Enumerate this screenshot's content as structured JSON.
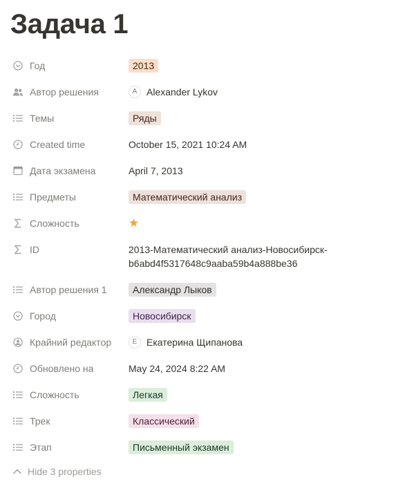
{
  "page": {
    "title": "Задача 1"
  },
  "properties": [
    {
      "key": "Год",
      "icon": "select-icon",
      "type": "tag",
      "value": "2013",
      "color": "orange"
    },
    {
      "key": "Автор решения",
      "icon": "people-icon",
      "type": "person",
      "value": "Alexander Lykov",
      "initial": "A"
    },
    {
      "key": "Темы",
      "icon": "list-icon",
      "type": "tag",
      "value": "Ряды",
      "color": "brown"
    },
    {
      "key": "Created time",
      "icon": "clock-icon",
      "type": "text",
      "value": "October 15, 2021 10:24 AM"
    },
    {
      "key": "Дата экзамена",
      "icon": "calendar-icon",
      "type": "text",
      "value": "April 7, 2013"
    },
    {
      "key": "Предметы",
      "icon": "list-icon",
      "type": "tag",
      "value": "Математический анализ",
      "color": "brown"
    },
    {
      "key": "Сложность",
      "icon": "formula-icon",
      "type": "stars",
      "value": "★",
      "rating": 1
    },
    {
      "key": "ID",
      "icon": "formula-icon",
      "type": "multiline",
      "value_line1": "2013-Математический анализ-Новосибирск-",
      "value_line2": "b6abd4f5317648c9aaba59b4a888be36"
    },
    {
      "key": "Автор решения 1",
      "icon": "list-icon",
      "type": "tag",
      "value": "Александр Лыков",
      "color": "gray"
    },
    {
      "key": "Город",
      "icon": "select-icon",
      "type": "tag",
      "value": "Новосибирск",
      "color": "purple"
    },
    {
      "key": "Крайний редактор",
      "icon": "person-circle-icon",
      "type": "person",
      "value": "Екатерина Щипанова",
      "initial": "E"
    },
    {
      "key": "Обновлено на",
      "icon": "clock-icon",
      "type": "text",
      "value": "May 24, 2024 8:22 AM"
    },
    {
      "key": "Сложность",
      "icon": "list-icon",
      "type": "tag",
      "value": "Легкая",
      "color": "green"
    },
    {
      "key": "Трек",
      "icon": "list-icon",
      "type": "tag",
      "value": "Классический",
      "color": "pink"
    },
    {
      "key": "Этап",
      "icon": "list-icon",
      "type": "tag",
      "value": "Письменный экзамен",
      "color": "green"
    }
  ],
  "footer": {
    "hide_label": "Hide 3 properties"
  },
  "colors": {
    "star": "#f2a43a",
    "text": "#37352f"
  }
}
